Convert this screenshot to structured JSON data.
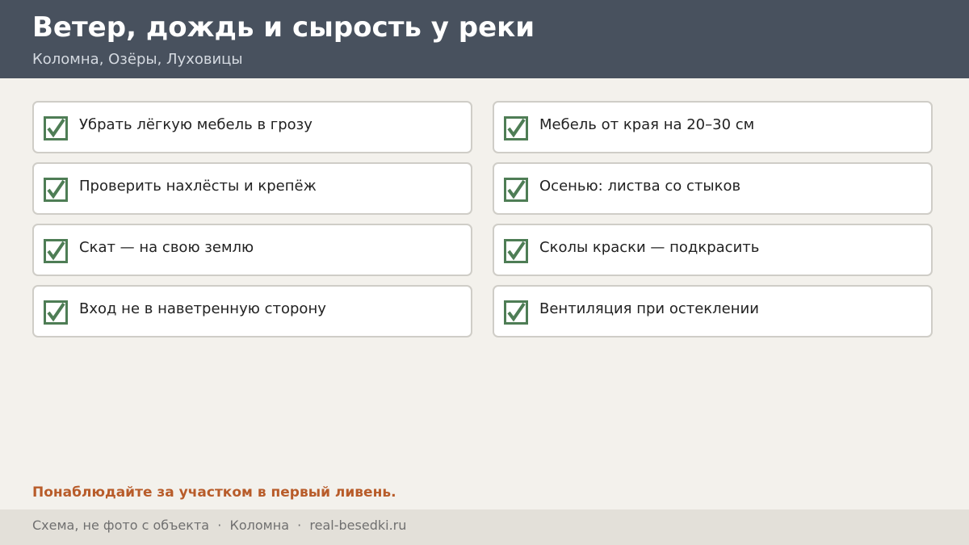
{
  "header": {
    "title": "Ветер, дождь и сырость у реки",
    "subtitle": "Коломна, Озёры, Луховицы"
  },
  "checklist": [
    {
      "label": "Убрать лёгкую мебель в грозу",
      "checked": true
    },
    {
      "label": "Мебель от края на 20–30 см",
      "checked": true
    },
    {
      "label": "Проверить нахлёсты и крепёж",
      "checked": true
    },
    {
      "label": "Осенью: листва со стыков",
      "checked": true
    },
    {
      "label": "Скат — на свою землю",
      "checked": true
    },
    {
      "label": "Сколы краски — подкрасить",
      "checked": true
    },
    {
      "label": "Вход не в наветренную сторону",
      "checked": true
    },
    {
      "label": "Вентиляция при остеклении",
      "checked": true
    }
  ],
  "note": "Понаблюдайте за участком в первый ливень.",
  "footer": {
    "text": "Схема, не фото с объекта  ·  Коломна  ·  real-besedki.ru"
  },
  "colors": {
    "header_bg": "#48515e",
    "check_green": "#4e7d55",
    "accent_orange": "#b85c2a"
  },
  "icons": {
    "check": "checkbox-checked-icon"
  }
}
